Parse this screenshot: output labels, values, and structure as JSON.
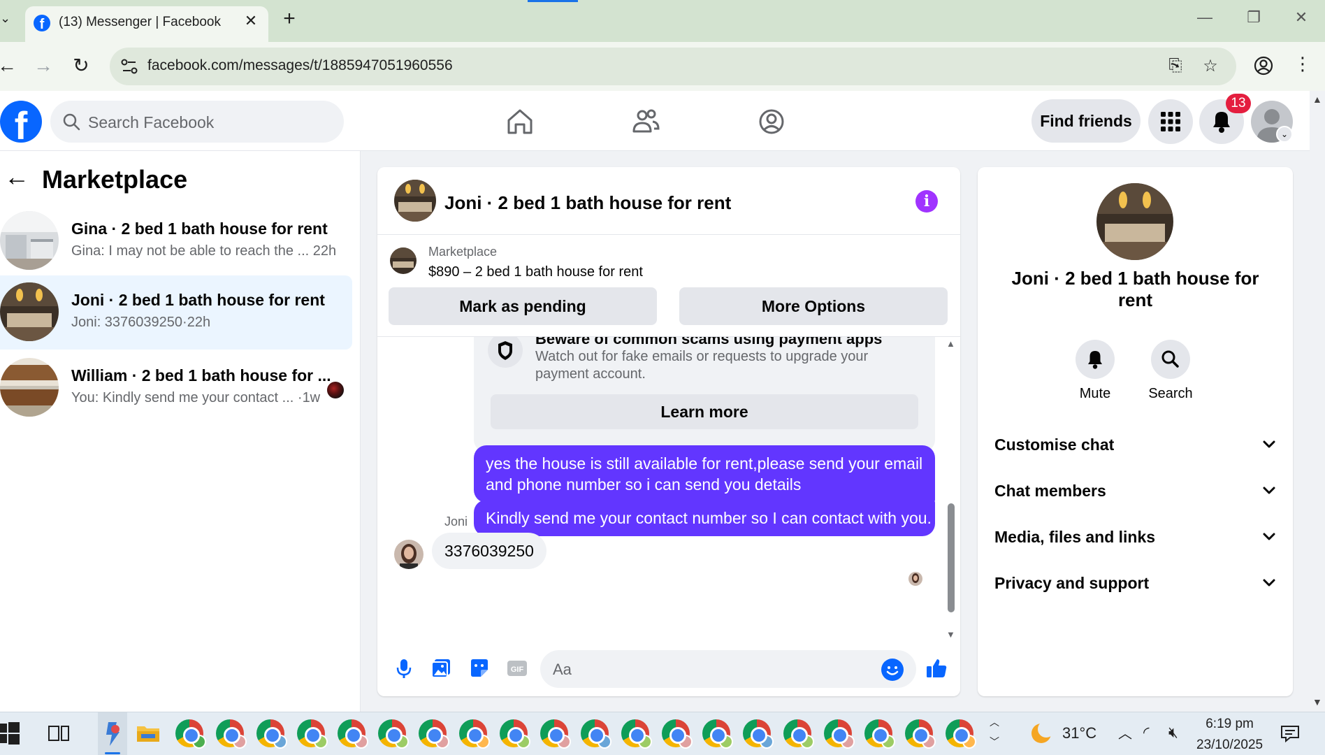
{
  "browser": {
    "tab_title": "(13) Messenger | Facebook",
    "url": "facebook.com/messages/t/1885947051960556"
  },
  "facebook": {
    "search_placeholder": "Search Facebook",
    "find_friends": "Find friends",
    "notification_count": "13"
  },
  "sidebar": {
    "title": "Marketplace",
    "conversations": [
      {
        "title": "Gina · 2 bed 1 bath house for rent",
        "preview": "Gina: I may not be able to reach the ...",
        "time": "22h",
        "active": false
      },
      {
        "title": "Joni · 2 bed 1 bath house for rent",
        "preview": "Joni: 3376039250",
        "time": "22h",
        "active": true
      },
      {
        "title": "William · 2 bed 1 bath house for ...",
        "preview": "You: Kindly send me your contact ...",
        "time": "1w",
        "active": false
      }
    ]
  },
  "chat": {
    "title": "Joni · 2 bed 1 bath house for rent",
    "marketplace_label": "Marketplace",
    "listing": "$890 – 2 bed 1 bath house for rent",
    "mark_pending": "Mark as pending",
    "more_options": "More Options",
    "warning_title": "Beware of common scams using payment apps",
    "warning_text": "Watch out for fake emails or requests to upgrade your payment account.",
    "learn_more": "Learn more",
    "messages_out": [
      "yes the house is still available for rent,please send your email and phone number so i can send you details",
      "Kindly send me your contact number so I can contact with you."
    ],
    "sender_name": "Joni",
    "message_in": "3376039250",
    "composer_placeholder": "Aa"
  },
  "info_panel": {
    "name": "Joni · 2 bed 1 bath house for rent",
    "mute": "Mute",
    "search": "Search",
    "sections": [
      "Customise chat",
      "Chat members",
      "Media, files and links",
      "Privacy and support"
    ]
  },
  "taskbar": {
    "weather": "31°C",
    "time": "6:19 pm",
    "date": "23/10/2025"
  },
  "colors": {
    "facebook_blue": "#0866ff",
    "outgoing_bubble": "#6236ff",
    "active_conversation": "#ebf5ff",
    "info_purple": "#a033ff",
    "notification_red": "#e41e3f"
  }
}
